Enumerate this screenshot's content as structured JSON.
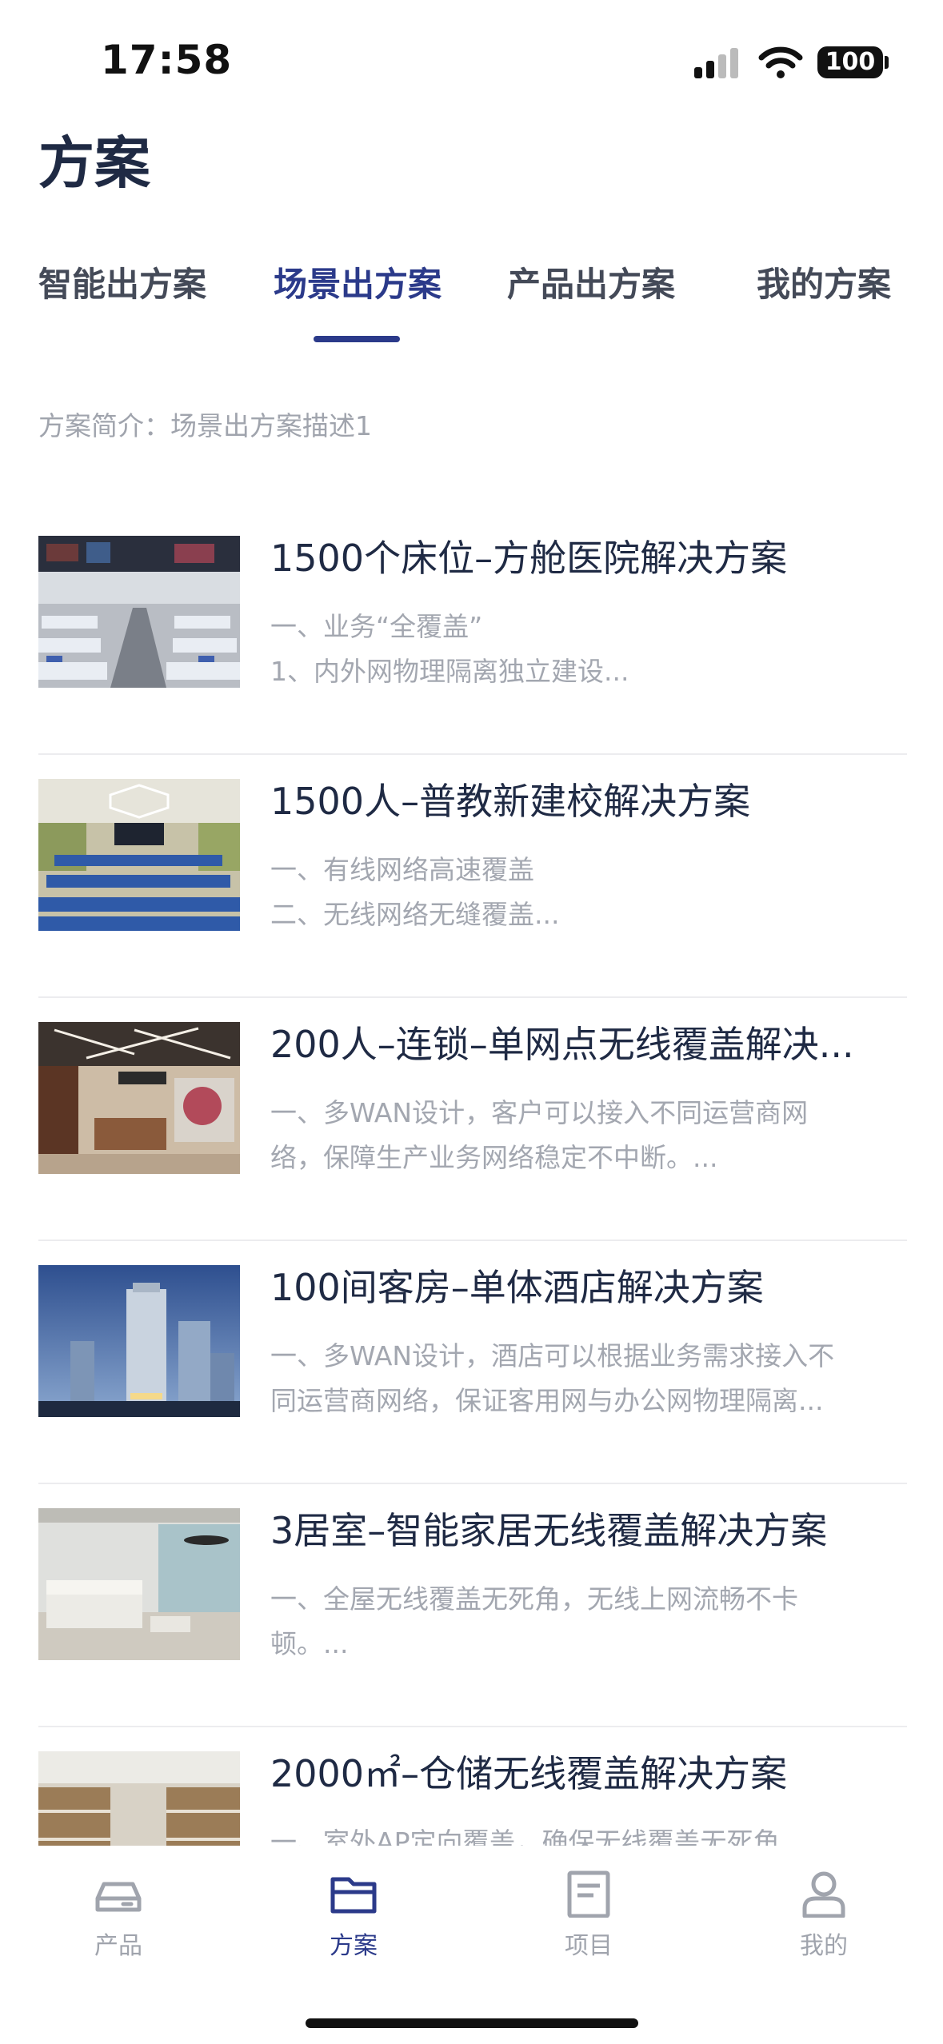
{
  "status": {
    "time": "17:58",
    "battery": "100"
  },
  "page_title": "方案",
  "tabs": [
    {
      "label": "智能出方案"
    },
    {
      "label": "场景出方案"
    },
    {
      "label": "产品出方案"
    },
    {
      "label": "我的方案"
    }
  ],
  "active_tab": "场景出方案",
  "intro": "方案简介：场景出方案描述1",
  "solutions": [
    {
      "title": "1500个床位–方舱医院解决方案",
      "line1": "一、业务“全覆盖”",
      "line2": "1、内外网物理隔离独立建设...",
      "image": "hospital-beds"
    },
    {
      "title": "1500人–普教新建校解决方案",
      "line1": "一、有线网络高速覆盖",
      "line2": "二、无线网络无缝覆盖...",
      "image": "classroom"
    },
    {
      "title": "200人–连锁–单网点无线覆盖解决...",
      "line1": "一、多WAN设计，客户可以接入不同运营商网",
      "line2": "络，保障生产业务网络稳定不中断。...",
      "image": "coffee-shop"
    },
    {
      "title": "100间客房–单体酒店解决方案",
      "line1": "一、多WAN设计，酒店可以根据业务需求接入不",
      "line2": "同运营商网络，保证客用网与办公网物理隔离...",
      "image": "hotel-building"
    },
    {
      "title": "3居室–智能家居无线覆盖解决方案",
      "line1": "一、全屋无线覆盖无死角，无线上网流畅不卡",
      "line2": "顿。...",
      "image": "living-room"
    },
    {
      "title": "2000㎡–仓储无线覆盖解决方案",
      "line1": "一、室外AP定向覆盖，确保无线覆盖无死角",
      "line2": "",
      "image": "warehouse"
    }
  ],
  "bottom_nav": [
    {
      "label": "产品",
      "icon": "router-icon"
    },
    {
      "label": "方案",
      "icon": "folder-icon"
    },
    {
      "label": "项目",
      "icon": "document-icon"
    },
    {
      "label": "我的",
      "icon": "user-icon"
    }
  ],
  "active_nav": "方案",
  "colors": {
    "accent": "#2b3a8a",
    "text": "#1f2a44",
    "muted": "#a0a4ad",
    "divider": "#ececef"
  }
}
